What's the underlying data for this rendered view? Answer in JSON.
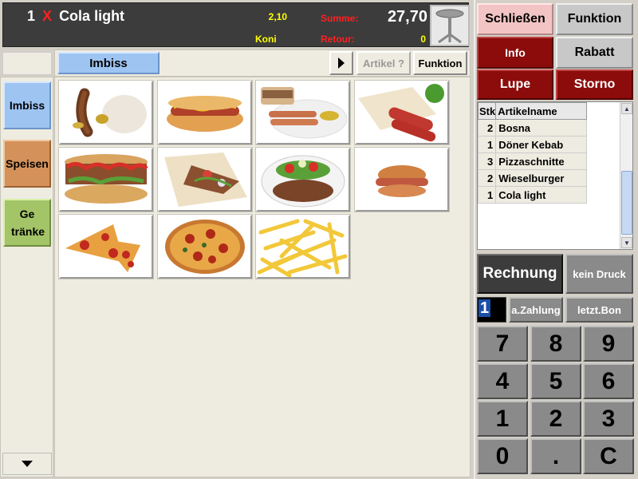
{
  "header": {
    "last_item_qty": "1",
    "last_item_x": "X",
    "last_item_name": "Cola light",
    "price": "2,10",
    "koni": "Koni",
    "summe_label": "Summe:",
    "summe_value": "27,70",
    "retour_label": "Retour:",
    "retour_value": "0"
  },
  "categories": [
    {
      "label": "Imbiss",
      "color": "#9ec4f2"
    },
    {
      "label": "Speisen",
      "color": "#d4925a"
    },
    {
      "label": "Ge tränke",
      "color": "#a4c468"
    }
  ],
  "toolbar": {
    "current_category": "Imbiss",
    "artikel_label": "Artikel ?",
    "funktion_label": "Funktion"
  },
  "products": [
    {
      "icon": "bratwurst-image"
    },
    {
      "icon": "hotdog-image"
    },
    {
      "icon": "sausage-plate-image"
    },
    {
      "icon": "wrap-hotdog-image"
    },
    {
      "icon": "doener-sandwich-image"
    },
    {
      "icon": "doener-wrap-image"
    },
    {
      "icon": "doener-plate-image"
    },
    {
      "icon": "leberkaese-burger-image"
    },
    {
      "icon": "pizza-slice-image"
    },
    {
      "icon": "whole-pizza-image"
    },
    {
      "icon": "fries-image"
    }
  ],
  "right": {
    "schliessen": "Schließen",
    "funktion": "Funktion",
    "info": "Info",
    "rabatt": "Rabatt",
    "lupe": "Lupe",
    "storno": "Storno",
    "rechnung": "Rechnung",
    "kein_druck": "kein Druck",
    "qty": "1",
    "a_zahlung": "a.Zahlung",
    "letzt_bon": "letzt.Bon"
  },
  "order": {
    "headers": [
      "Stk",
      "Artikelname"
    ],
    "rows": [
      {
        "stk": "2",
        "name": "Bosna"
      },
      {
        "stk": "1",
        "name": "Döner Kebab"
      },
      {
        "stk": "3",
        "name": "Pizzaschnitte"
      },
      {
        "stk": "2",
        "name": "Wieselburger"
      },
      {
        "stk": "1",
        "name": "Cola light"
      }
    ]
  },
  "numpad": [
    "7",
    "8",
    "9",
    "4",
    "5",
    "6",
    "1",
    "2",
    "3",
    "0",
    ".",
    "C"
  ]
}
